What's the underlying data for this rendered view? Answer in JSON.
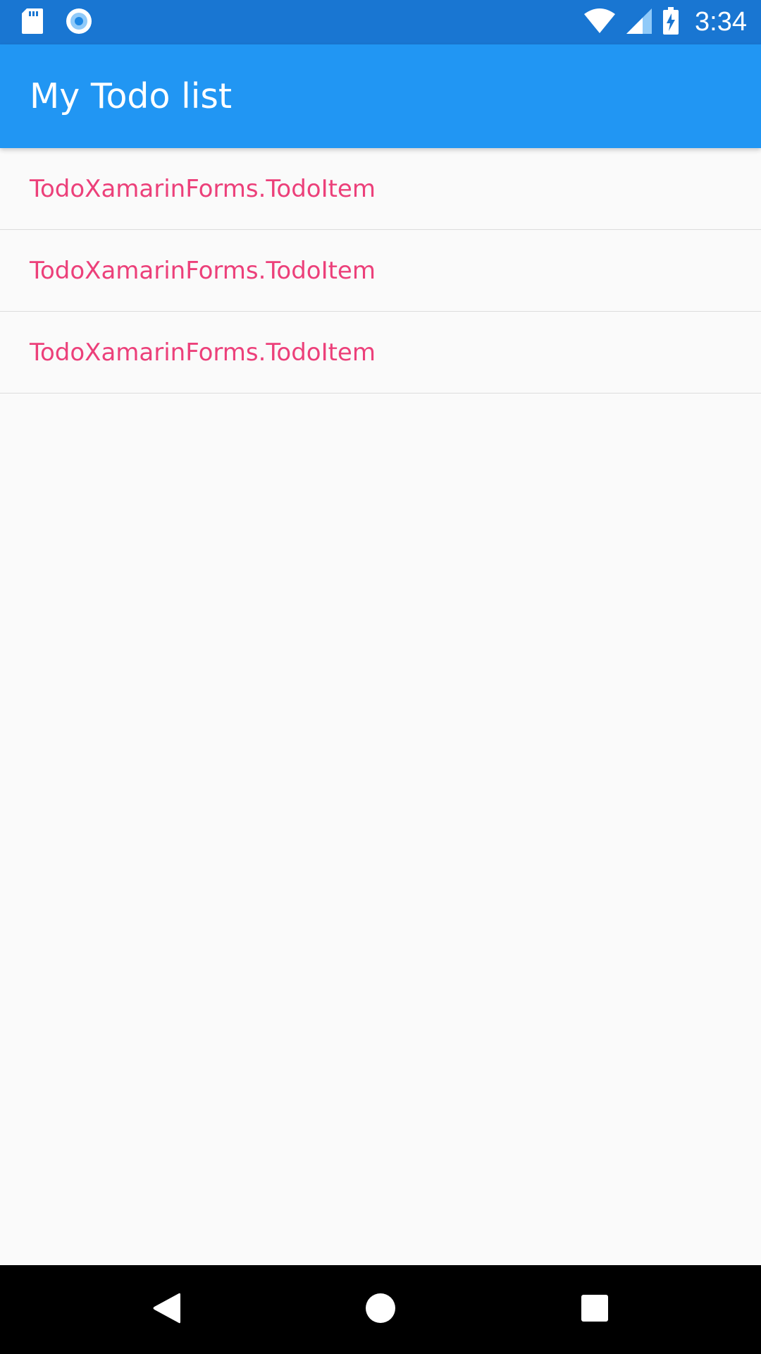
{
  "status_bar": {
    "time": "3:34",
    "icons": [
      "sd-card-icon",
      "sync-circle-icon",
      "wifi-icon",
      "cell-signal-icon",
      "battery-charging-icon"
    ],
    "background": "#1976d2"
  },
  "app_bar": {
    "title": "My Todo list",
    "background": "#2196f3"
  },
  "todo_list": {
    "items": [
      {
        "label": "TodoXamarinForms.TodoItem"
      },
      {
        "label": "TodoXamarinForms.TodoItem"
      },
      {
        "label": "TodoXamarinForms.TodoItem"
      }
    ],
    "text_color": "#ec407a"
  },
  "nav_bar": {
    "buttons": [
      "back-icon",
      "home-icon",
      "recents-icon"
    ]
  }
}
